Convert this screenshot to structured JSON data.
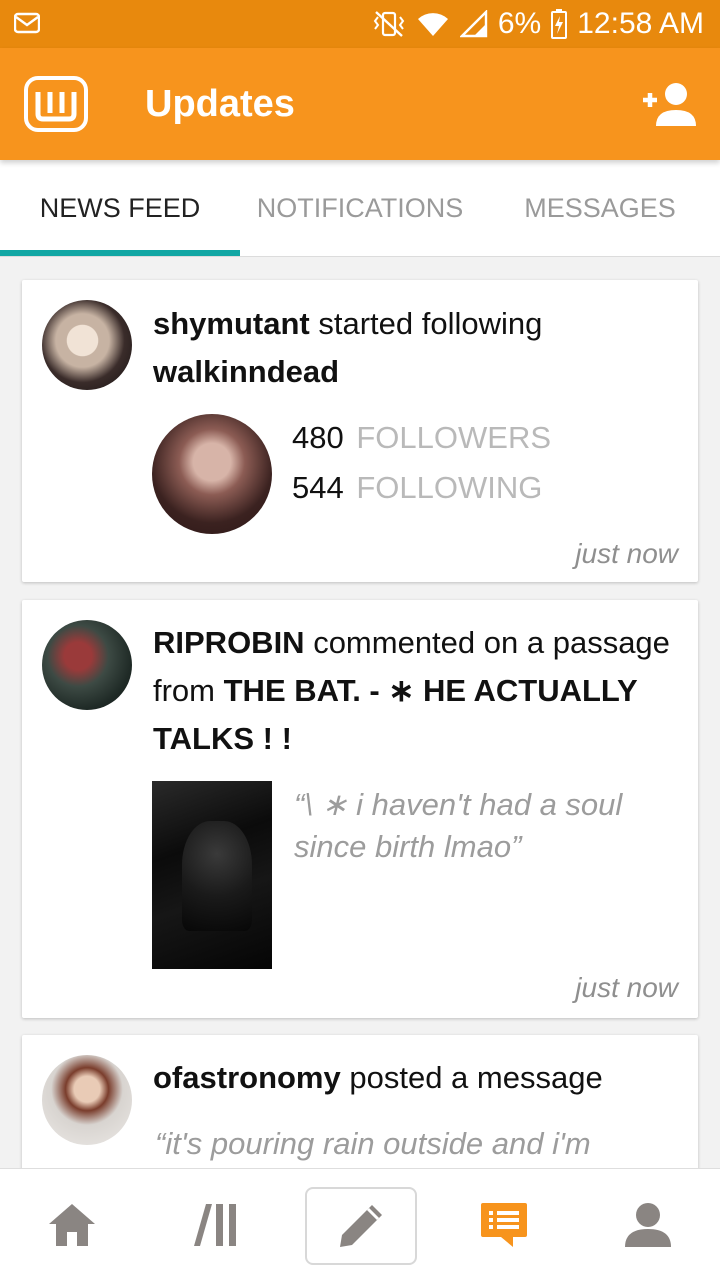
{
  "status_bar": {
    "battery": "6%",
    "time": "12:58 AM"
  },
  "app_bar": {
    "title": "Updates"
  },
  "tabs": [
    {
      "label": "NEWS FEED",
      "active": true
    },
    {
      "label": "NOTIFICATIONS",
      "active": false
    },
    {
      "label": "MESSAGES",
      "active": false
    }
  ],
  "feed": [
    {
      "user": "shymutant",
      "action": " started following ",
      "target": "walkinndead",
      "followers_count": "480",
      "followers_label": "FOLLOWERS",
      "following_count": "544",
      "following_label": "FOLLOWING",
      "time": "just now"
    },
    {
      "user": "RIPROBIN",
      "action": " commented on a passage from ",
      "target": "THE BAT. - ∗ HE ACTUALLY TALKS ! !",
      "quote": "“\\ ∗ i haven't had a soul since birth lmao”",
      "time": "just now"
    },
    {
      "user": "ofastronomy",
      "action": " posted a message",
      "quote": "“it's pouring rain outside and i'm"
    }
  ],
  "bottom_nav": [
    {
      "icon": "home-icon"
    },
    {
      "icon": "library-icon"
    },
    {
      "icon": "pencil-icon"
    },
    {
      "icon": "messages-icon"
    },
    {
      "icon": "profile-icon"
    }
  ],
  "colors": {
    "status_bar": "#e8890d",
    "app_bar": "#f7941d",
    "tab_indicator": "#12a7a4",
    "accent_icon": "#f7941d"
  }
}
